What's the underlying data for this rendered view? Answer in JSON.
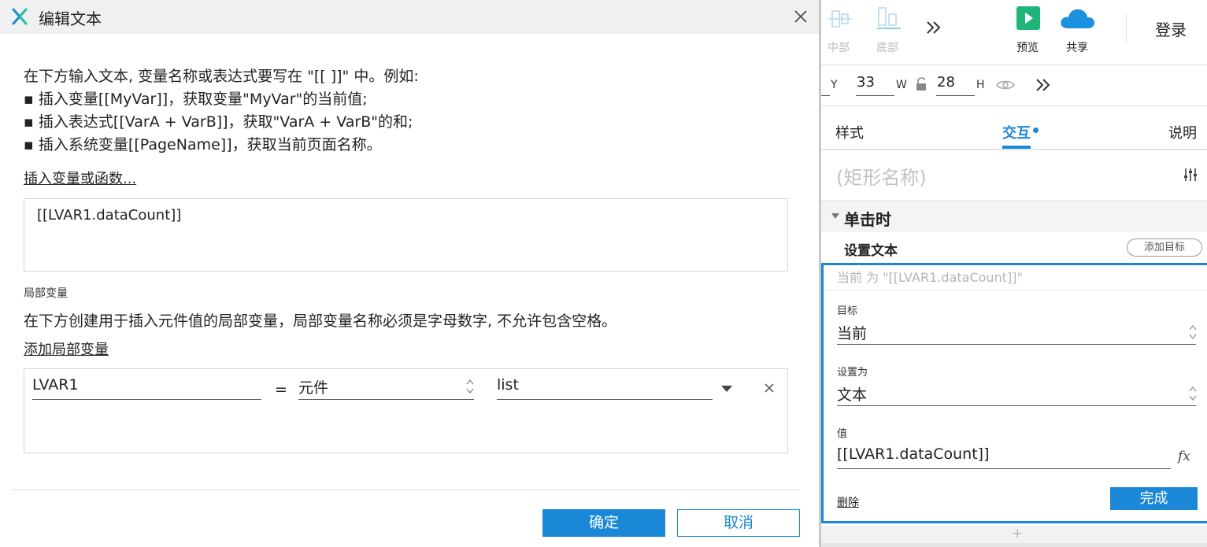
{
  "dialog": {
    "title": "编辑文本",
    "instructions": [
      "在下方输入文本, 变量名称或表达式要写在 \"[[ ]]\" 中。例如:",
      "▪ 插入变量[[MyVar]]，获取变量\"MyVar\"的当前值;",
      "▪ 插入表达式[[VarA + VarB]]，获取\"VarA + VarB\"的和;",
      "▪ 插入系统变量[[PageName]]，获取当前页面名称。"
    ],
    "insert_link": "插入变量或函数...",
    "expression": "[[LVAR1.dataCount]]",
    "local_vars_heading": "局部变量",
    "local_vars_desc": "在下方创建用于插入元件值的局部变量，局部变量名称必须是字母数字, 不允许包含空格。",
    "add_local_var_link": "添加局部变量",
    "local_var": {
      "name": "LVAR1",
      "equals": "=",
      "type": "元件",
      "target": "list"
    },
    "ok_label": "确定",
    "cancel_label": "取消"
  },
  "toolbar": {
    "items": [
      {
        "label": "中部",
        "icon": "align-middle-icon",
        "enabled": false
      },
      {
        "label": "底部",
        "icon": "align-bottom-icon",
        "enabled": false
      },
      {
        "label": "预览",
        "icon": "preview-play-icon",
        "enabled": true
      },
      {
        "label": "共享",
        "icon": "share-cloud-icon",
        "enabled": true
      }
    ],
    "more_icon": "double-chevron-right-icon",
    "login_label": "登录"
  },
  "coords": {
    "y_label": "Y",
    "y_value": "33",
    "w_label": "W",
    "w_value": "28",
    "h_label": "H"
  },
  "tabs": {
    "style": "样式",
    "interaction": "交互",
    "notes": "说明",
    "active": "interaction"
  },
  "shape_name_placeholder": "(矩形名称)",
  "event": {
    "label": "单击时",
    "action_label": "设置文本",
    "add_target_label": "添加目标",
    "summary": "当前 为 \"[[LVAR1.dataCount]]\"",
    "target_label": "目标",
    "target_value": "当前",
    "set_to_label": "设置为",
    "set_to_value": "文本",
    "value_label": "值",
    "value": "[[LVAR1.dataCount]]",
    "fx_label": "fx",
    "delete_label": "删除",
    "done_label": "完成",
    "add_action_symbol": "+"
  },
  "colors": {
    "accent": "#1a88d7",
    "logo_blue": "#1a88d7",
    "logo_teal": "#18c0a8",
    "preview_green": "#1fb57a",
    "share_blue": "#1e90e0"
  }
}
